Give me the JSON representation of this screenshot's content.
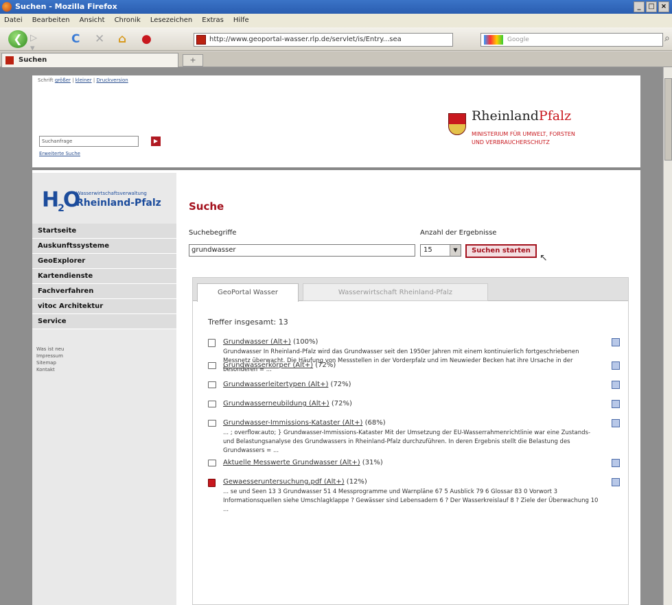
{
  "window": {
    "title": "Suchen - Mozilla Firefox",
    "controls": [
      "_",
      "□",
      "×"
    ]
  },
  "menu": [
    "Datei",
    "Bearbeiten",
    "Ansicht",
    "Chronik",
    "Lesezeichen",
    "Extras",
    "Hilfe"
  ],
  "nav": {
    "url": "http://www.geoportal-wasser.rlp.de/servlet/is/Entry...sea",
    "search_placeholder": "Google"
  },
  "tab": {
    "label": "Suchen",
    "newtab": "+"
  },
  "header": {
    "fontsize": [
      "Schrift",
      "größer",
      "kleiner",
      "Druckversion"
    ],
    "query_placeholder": "Suchanfrage",
    "query_btn": "▶",
    "advanced": "Erweiterte Suche",
    "state": "RheinlandPfalz",
    "state_a": "Rheinland",
    "state_b": "Pfalz",
    "ministry_1": "MINISTERIUM FÜR UMWELT, FORSTEN",
    "ministry_2": "UND VERBRAUCHERSCHUTZ"
  },
  "logo": {
    "big": "H2O",
    "sub": "Wasserwirtschaftsverwaltung",
    "region": "Rheinland-Pfalz"
  },
  "sidebar": {
    "items": [
      "Startseite",
      "Auskunftssysteme",
      "GeoExplorer",
      "Kartendienste",
      "Fachverfahren",
      "vitoc Architektur",
      "Service"
    ],
    "links": [
      "Was ist neu",
      "Impressum",
      "Sitemap",
      "Kontakt"
    ]
  },
  "search": {
    "heading": "Suche",
    "terms_label": "Suchebegriffe",
    "count_label": "Anzahl der Ergebnisse",
    "terms_value": "grundwasser",
    "count_value": "15",
    "submit": "Suchen starten"
  },
  "results_tabs": [
    "GeoPortal Wasser",
    "Wasserwirtschaft Rheinland-Pfalz"
  ],
  "results_total": "Treffer insgesamt: 13",
  "results": [
    {
      "title": "Grundwasser (Alt+)",
      "pct": "(100%)",
      "icon": "doc",
      "snippet": "Grundwasser In Rheinland-Pfalz wird das Grundwasser seit den 1950er Jahren mit einem kontinuierlich fortgeschriebenen Messnetz überwacht. Die Häufung von Messstellen in der Vorderpfalz und im Neuwieder Becken hat ihre Ursache in der besonderen = ..."
    },
    {
      "title": "Grundwasserkörper (Alt+)",
      "pct": "(72%)",
      "icon": "folder",
      "snippet": ""
    },
    {
      "title": "Grundwasserleitertypen (Alt+)",
      "pct": "(72%)",
      "icon": "folder",
      "snippet": ""
    },
    {
      "title": "Grundwasserneubildung (Alt+)",
      "pct": "(72%)",
      "icon": "folder",
      "snippet": ""
    },
    {
      "title": "Grundwasser-Immissions-Kataster (Alt+)",
      "pct": "(68%)",
      "icon": "folder",
      "snippet": "... ; overflow:auto; } Grundwasser-Immissions-Kataster Mit der Umsetzung der EU-Wasserrahmenrichtlinie war eine Zustands- und Belastungsanalyse des Grundwassers in Rheinland-Pfalz durchzuführen. In deren Ergebnis stellt die Belastung des Grundwassers = ..."
    },
    {
      "title": "Aktuelle Messwerte Grundwasser (Alt+)",
      "pct": "(31%)",
      "icon": "folder",
      "snippet": ""
    },
    {
      "title": "Gewaesseruntersuchung.pdf (Alt+)",
      "pct": "(12%)",
      "icon": "pdf",
      "snippet": "... se und Seen 13 3 Grundwasser 51 4 Messprogramme und Warnpläne 67 5 Ausblick 79 6 Glossar 83 0 Vorwort 3 Informationsquellen siehe Umschlagklappe ? Gewässer sind Lebensadern 6 ? Der Wasserkreislauf 8 ? Ziele der Überwachung 10 ..."
    }
  ]
}
